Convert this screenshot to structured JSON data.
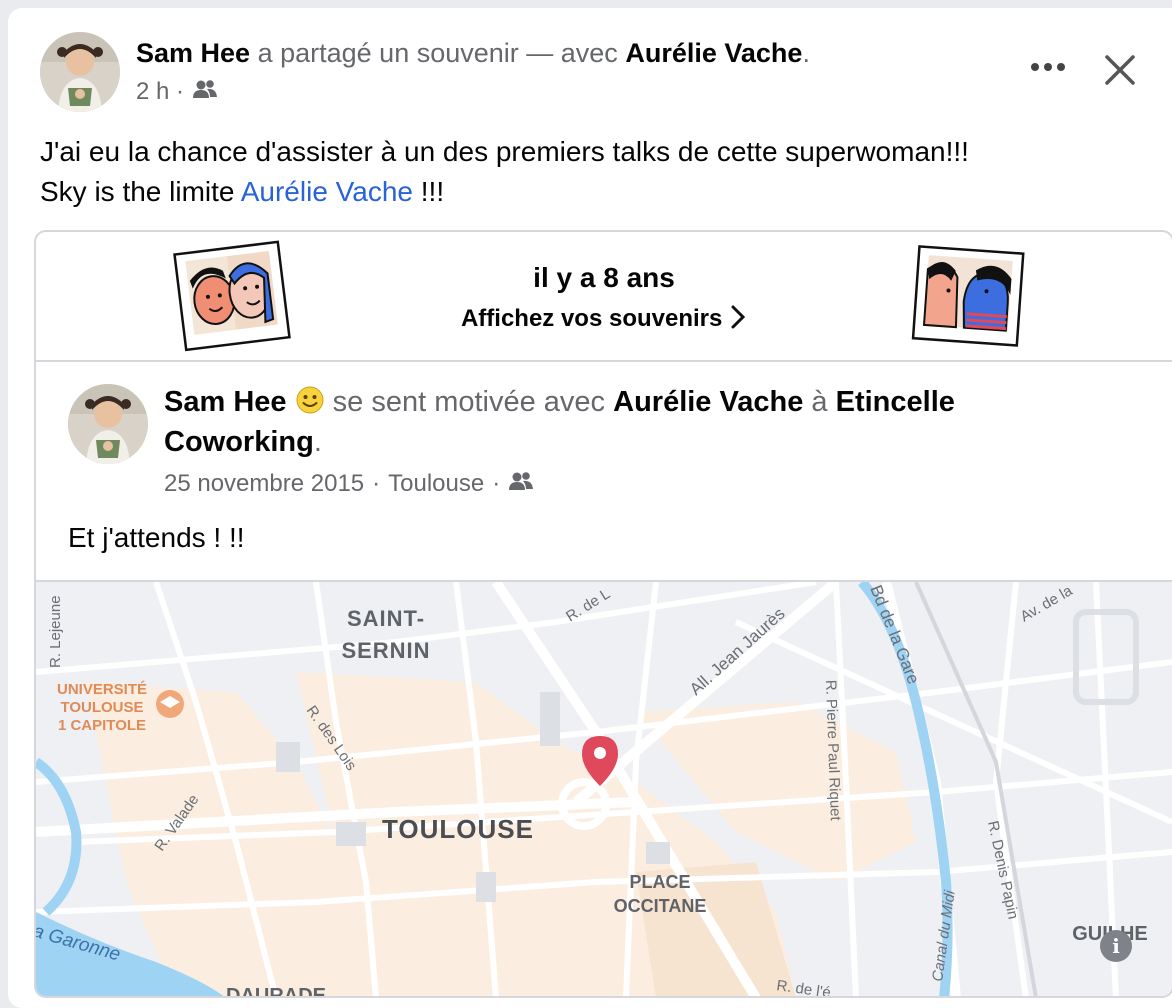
{
  "post": {
    "author": "Sam Hee",
    "action": "a partagé un souvenir — avec",
    "tagged": "Aurélie Vache",
    "period": ".",
    "time": "2 h ·",
    "message_line1": "J'ai eu la chance d'assister à un des premiers talks de cette superwoman!!!",
    "message_line2_prefix": "Sky is the limite",
    "message_link": "Aurélie Vache",
    "message_line2_suffix": "!!!"
  },
  "memory": {
    "title": "il y a 8 ans",
    "subtitle": "Affichez vos souvenirs",
    "chevron": "›"
  },
  "original": {
    "author": "Sam Hee",
    "feeling": "se sent motivée avec",
    "tagged": "Aurélie Vache",
    "at": "à",
    "place": "Etincelle Coworking",
    "period": ".",
    "date": "25 novembre 2015",
    "location": "Toulouse",
    "sep": "·",
    "text": "Et j'attends ! !!"
  },
  "map": {
    "labels": {
      "saint1": "SAINT-",
      "saint2": "SERNIN",
      "univ1": "UNIVERSITÉ",
      "univ2": "TOULOUSE",
      "univ3": "1 CAPITOLE",
      "toulouse": "TOULOUSE",
      "place1": "PLACE",
      "place2": "OCCITANE",
      "guilhe": "GUILHE",
      "daurade": "DAURADE",
      "garonne": "a Garonne",
      "lejeune": "R. Lejeune",
      "rde": "R. de L",
      "jaures": "All. Jean Jaurès",
      "bdgare": "Bd de la Gare",
      "avdela": "Av. de la",
      "riquet": "R. Pierre Paul Riquet",
      "lois": "R. des Lois",
      "valade": "R. Valade",
      "canal": "Canal du Midi",
      "papin": "R. Denis Papin",
      "rdel2": "R. de l'é"
    },
    "info": "i"
  },
  "colors": {
    "link": "#2864d8",
    "pin": "#e0485c",
    "water": "#9fd3f4",
    "urban": "#fbeee0"
  },
  "icons": [
    "friends-icon",
    "more-icon",
    "close-icon",
    "smile-emoji-icon",
    "map-pin-icon",
    "info-icon"
  ]
}
